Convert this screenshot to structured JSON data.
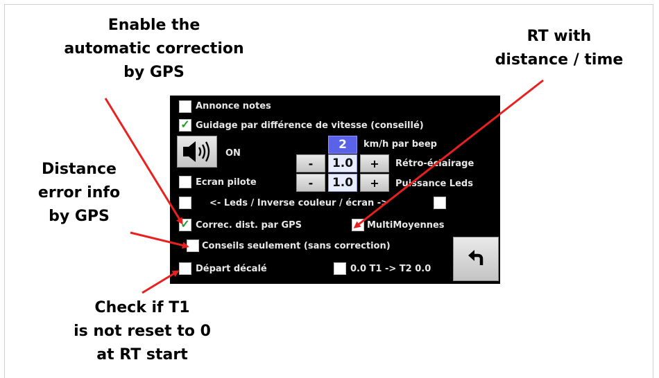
{
  "annotations": {
    "gps_correction": [
      "Enable the",
      "automatic correction",
      "by GPS"
    ],
    "rt_distance": [
      "RT with",
      "distance / time"
    ],
    "distance_error": [
      "Distance",
      "error info",
      "by GPS"
    ],
    "t1_reset": [
      "Check if T1",
      "is not reset to 0",
      "at RT start"
    ]
  },
  "panel": {
    "annonce_notes": {
      "label": "Annonce notes",
      "checked": false
    },
    "guidage": {
      "label": "Guidage par différence de vitesse (conseillé)",
      "checked": true
    },
    "speaker": {
      "state_label": "ON",
      "icon": "speaker-icon"
    },
    "beep": {
      "value": "2",
      "label": "km/h par beep"
    },
    "retro": {
      "minus": "-",
      "value": "1.0",
      "plus": "+",
      "label": "Rétro-éclairage"
    },
    "ecran_pilote": {
      "label": "Ecran pilote",
      "checked": false
    },
    "puissance": {
      "minus": "-",
      "value": "1.0",
      "plus": "+",
      "label": "Puissance Leds"
    },
    "leds_inverse": {
      "label": "<- Leds / Inverse couleur / écran ->",
      "left_checked": false,
      "right_checked": false
    },
    "correc_dist": {
      "label": "Correc. dist. par GPS",
      "checked": true
    },
    "multimoyennes": {
      "label": "MultiMoyennes",
      "checked": false
    },
    "conseils": {
      "label": "Conseils seulement (sans correction)",
      "checked": false
    },
    "depart": {
      "label": "Départ décalé",
      "checked": false
    },
    "t1t2": {
      "label": "0.0 T1 -> T2 0.0",
      "checked": false
    },
    "back": {
      "icon": "undo-arrow-icon"
    }
  },
  "colors": {
    "panel_bg": "#000000",
    "check": "#1f9e2f",
    "arrow": "#e8201e",
    "value_blue": "#5a63e8"
  }
}
